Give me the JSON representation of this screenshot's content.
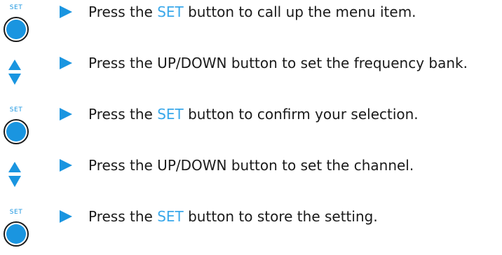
{
  "colors": {
    "accent": "#1a95e0",
    "accent_text": "#3aa8ea",
    "text": "#1a1a1a"
  },
  "icons": {
    "set_button_label": "SET",
    "set_button": "set-button-icon",
    "updown_button": "up-down-arrows-icon",
    "bullet": "triangle-bullet-icon"
  },
  "steps": [
    {
      "icon": "set",
      "before": "Press the ",
      "highlight": "SET",
      "after": " button to call up the menu item."
    },
    {
      "icon": "updown",
      "text": "Press the UP/DOWN button to set the frequency bank."
    },
    {
      "icon": "set",
      "before": "Press the ",
      "highlight": "SET",
      "after": " button to confirm your selection."
    },
    {
      "icon": "updown",
      "text": "Press the UP/DOWN button to set the channel."
    },
    {
      "icon": "set",
      "before": "Press the ",
      "highlight": "SET",
      "after": " button to store the setting."
    }
  ]
}
